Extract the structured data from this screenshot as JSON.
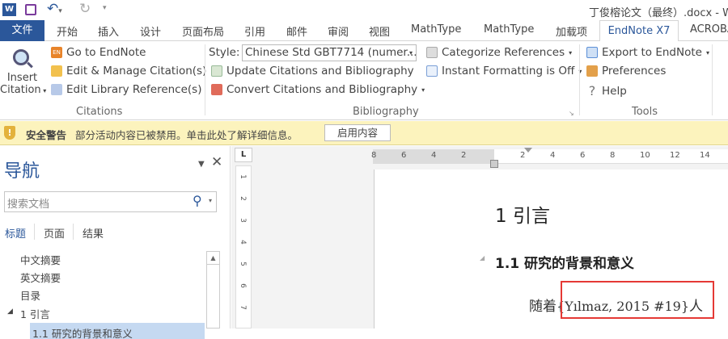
{
  "title_bar": {
    "document_title": "丁俊榕论文（最终）.docx - W"
  },
  "tabs": {
    "file": "文件",
    "items": [
      "开始",
      "插入",
      "设计",
      "页面布局",
      "引用",
      "邮件",
      "审阅",
      "视图",
      "MathType",
      "MathType",
      "加载项"
    ],
    "active": "EndNote X7",
    "last": "ACROBA"
  },
  "ribbon": {
    "insert_citation": "Insert",
    "insert_citation2": "Citation",
    "go_to_endnote": "Go to EndNote",
    "edit_manage": "Edit & Manage Citation(s)",
    "edit_library": "Edit Library Reference(s)",
    "citations_group": "Citations",
    "style_label": "Style:",
    "style_value": "Chinese Std GBT7714 (numer...",
    "update": "Update Citations and Bibliography",
    "convert": "Convert Citations and Bibliography",
    "categorize": "Categorize References",
    "instant": "Instant Formatting is Off",
    "bibliography_group": "Bibliography",
    "export": "Export to EndNote",
    "preferences": "Preferences",
    "help": "Help",
    "tools_group": "Tools"
  },
  "warning": {
    "title": "安全警告",
    "message": "部分活动内容已被禁用。单击此处了解详细信息。",
    "button": "启用内容"
  },
  "nav": {
    "title": "导航",
    "search_placeholder": "搜索文档",
    "tabs": [
      "标题",
      "页面",
      "结果"
    ],
    "items": [
      "中文摘要",
      "英文摘要",
      "目录",
      "1 引言",
      "1.1 研究的背景和意义"
    ]
  },
  "ruler": {
    "corner": "L",
    "h_ticks": [
      "8",
      "6",
      "4",
      "2",
      "2",
      "4",
      "6",
      "8",
      "10",
      "12",
      "14"
    ],
    "v_ticks": [
      "1",
      "2",
      "3",
      "4",
      "5",
      "6",
      "7"
    ]
  },
  "document": {
    "heading1": "1 引言",
    "heading2": "1.1 研究的背景和意义",
    "para_prefix": "随着",
    "citation": "{Yılmaz, 2015 #19}",
    "para_suffix": "人"
  },
  "colors": {
    "accent": "#2b579a",
    "warning_bg": "#fcf3bd",
    "highlight_box": "#e53935"
  }
}
